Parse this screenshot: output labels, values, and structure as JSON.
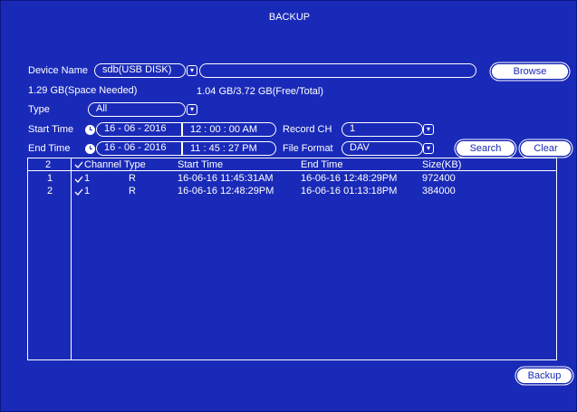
{
  "title": "BACKUP",
  "device": {
    "label": "Device Name",
    "value": "sdb(USB DISK)",
    "path_value": "",
    "browse_label": "Browse"
  },
  "space": {
    "needed": "1.29 GB(Space Needed)",
    "free_total": "1.04 GB/3.72 GB(Free/Total)"
  },
  "type": {
    "label": "Type",
    "value": "All"
  },
  "start_time": {
    "label": "Start Time",
    "date": "16 - 06 - 2016",
    "time": "12 : 00 : 00 AM"
  },
  "end_time": {
    "label": "End Time",
    "date": "16 - 06 - 2016",
    "time": "11 : 45 : 27 PM"
  },
  "record_ch": {
    "label": "Record CH",
    "value": "1"
  },
  "file_format": {
    "label": "File Format",
    "value": "DAV"
  },
  "buttons": {
    "search": "Search",
    "clear": "Clear",
    "backup": "Backup"
  },
  "table": {
    "count": "2",
    "columns": [
      "Channel Type",
      "Start Time",
      "End Time",
      "Size(KB)"
    ],
    "rows": [
      {
        "index": "1",
        "channel": "1",
        "type": "R",
        "start": "16-06-16 11:45:31AM",
        "end": "16-06-16 12:48:29PM",
        "size": "972400",
        "checked": true
      },
      {
        "index": "2",
        "channel": "1",
        "type": "R",
        "start": "16-06-16 12:48:29PM",
        "end": "16-06-16 01:13:18PM",
        "size": "384000",
        "checked": true
      }
    ]
  },
  "icons": {
    "clock": "clock-icon",
    "dropdown": "chevron-down-icon",
    "check": "checkmark-icon"
  },
  "colors": {
    "background": "#1a2ab8",
    "foreground": "#ffffff"
  }
}
